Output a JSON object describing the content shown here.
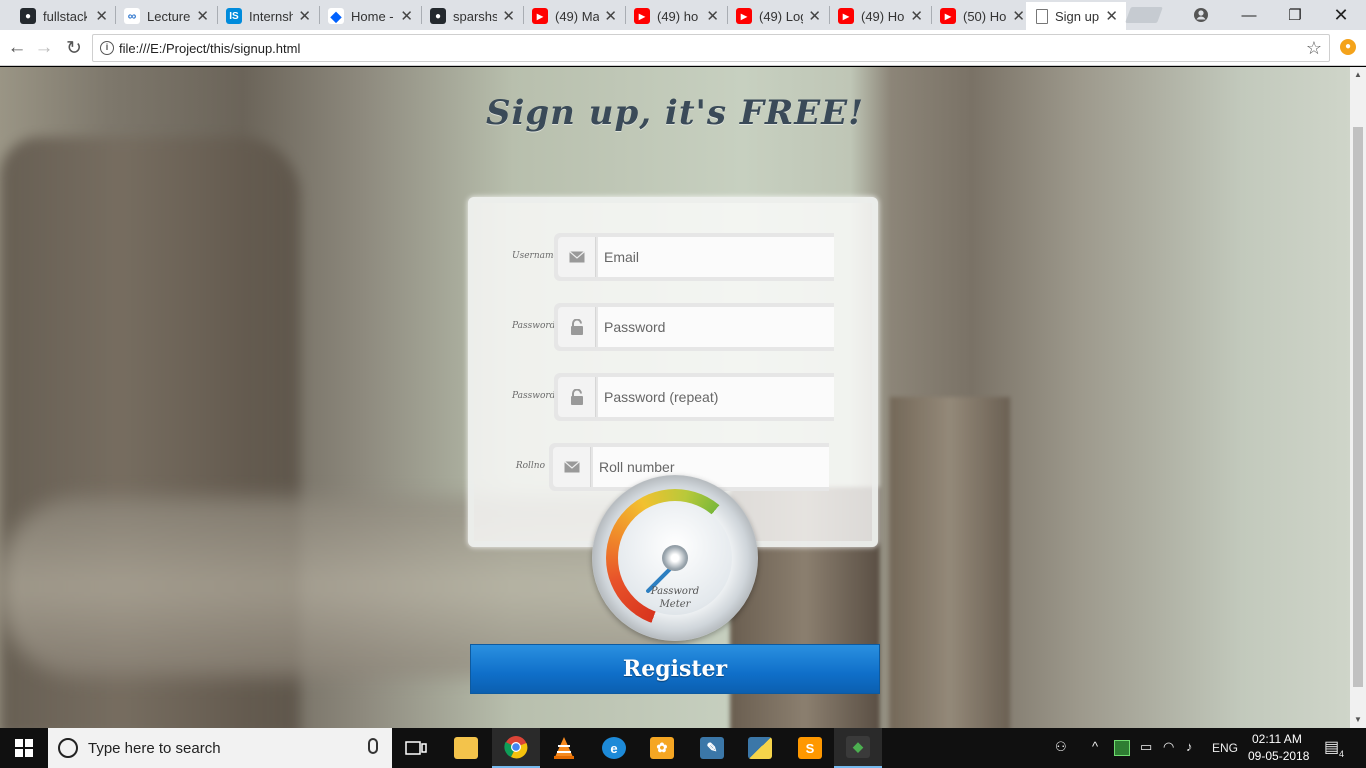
{
  "browser": {
    "tabs": [
      {
        "label": "fullstack",
        "icon": "github-icon",
        "color": "#24292e"
      },
      {
        "label": "Lecture",
        "icon": "coursera-icon",
        "color": "#2a73cc"
      },
      {
        "label": "Internsh",
        "icon": "internshala-icon",
        "color": "#008bdc"
      },
      {
        "label": "Home -",
        "icon": "dropbox-icon",
        "color": "#0061fe"
      },
      {
        "label": "sparshs",
        "icon": "github-icon",
        "color": "#24292e"
      },
      {
        "label": "(49) Ma",
        "icon": "youtube-icon",
        "color": "#ff0000"
      },
      {
        "label": "(49) ho",
        "icon": "youtube-icon",
        "color": "#ff0000"
      },
      {
        "label": "(49) Log",
        "icon": "youtube-icon",
        "color": "#ff0000"
      },
      {
        "label": "(49) Ho",
        "icon": "youtube-icon",
        "color": "#ff0000"
      },
      {
        "label": "(50) Ho",
        "icon": "youtube-icon",
        "color": "#ff0000"
      },
      {
        "label": "Sign up",
        "icon": "page-icon",
        "color": "#777777",
        "active": true
      }
    ],
    "url": "file:///E:/Project/this/signup.html"
  },
  "page": {
    "heading": "Sign up, it's FREE!",
    "fields": [
      {
        "label": "Username",
        "placeholder": "Email",
        "icon": "envelope-icon"
      },
      {
        "label": "Password",
        "placeholder": "Password",
        "icon": "lock-icon"
      },
      {
        "label": "Password",
        "placeholder": "Password (repeat)",
        "icon": "lock-icon"
      },
      {
        "label": "Rollno",
        "placeholder": "Roll number",
        "icon": "envelope-icon"
      }
    ],
    "meter": {
      "line1": "Password",
      "line2": "Meter"
    },
    "register_label": "Register",
    "accent_color": "#0f6fc9"
  },
  "taskbar": {
    "search_placeholder": "Type here to search",
    "apps": [
      "task-view-icon",
      "file-explorer-icon",
      "chrome-icon",
      "vlc-icon",
      "ie-icon",
      "fl-studio-icon",
      "python-idle-icon",
      "python-icon",
      "sublime-text-icon",
      "git-icon"
    ],
    "language": "ENG",
    "time": "02:11 AM",
    "date": "09-05-2018",
    "notification_count": "4"
  }
}
